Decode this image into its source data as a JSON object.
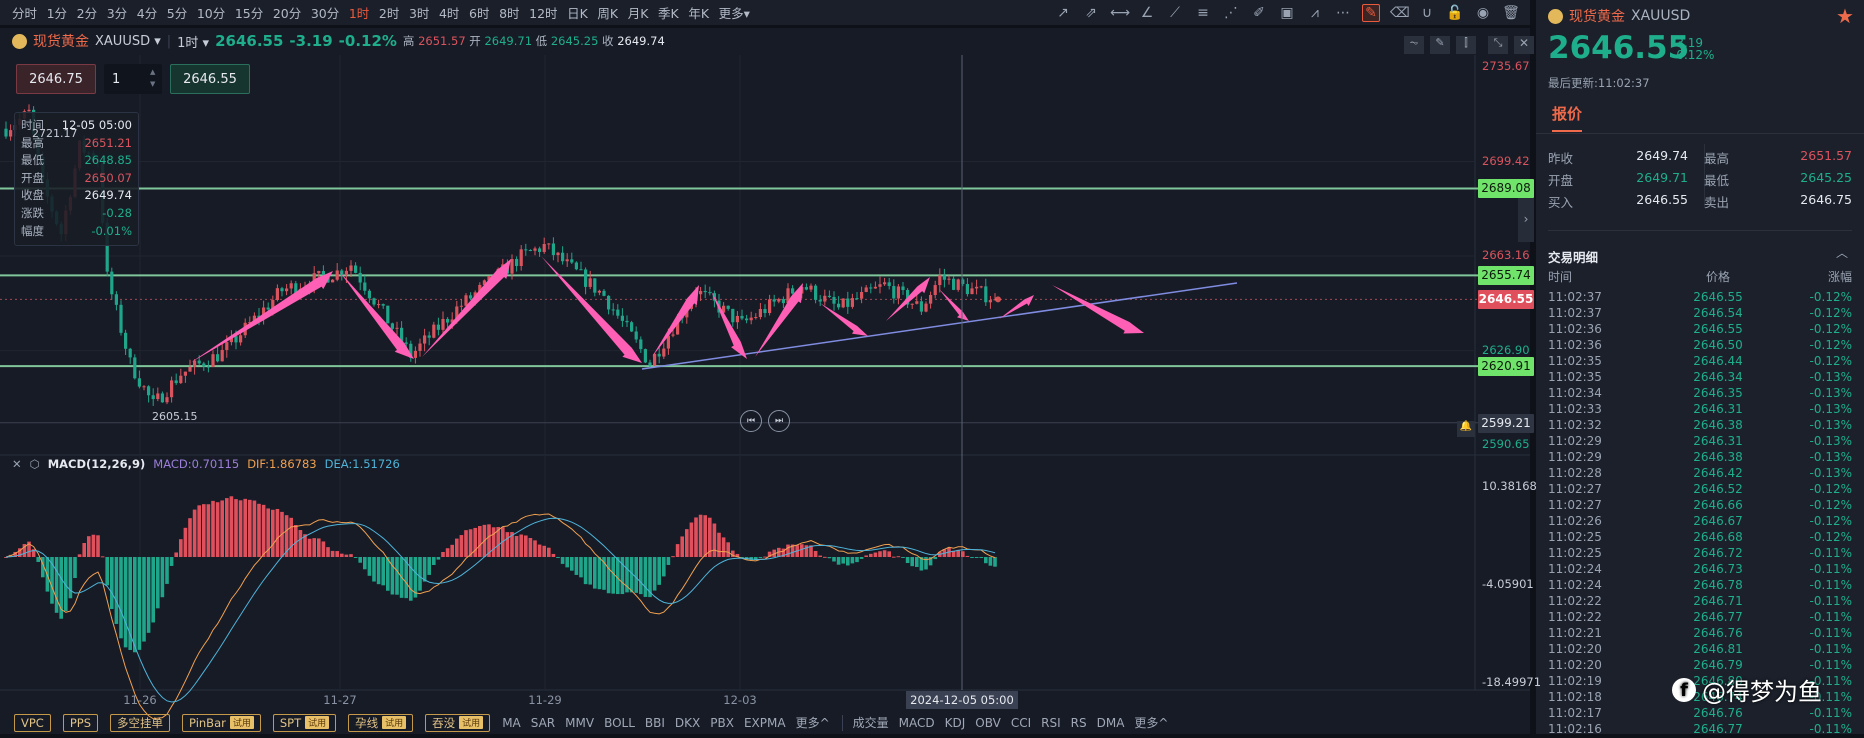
{
  "toolbar": {
    "intervals": [
      "分时",
      "1分",
      "2分",
      "3分",
      "4分",
      "5分",
      "10分",
      "15分",
      "20分",
      "30分",
      "1时",
      "2时",
      "3时",
      "4时",
      "6时",
      "8时",
      "12时",
      "日K",
      "周K",
      "月K",
      "季K",
      "年K",
      "更多▾"
    ],
    "active_index": 10,
    "drawing_tools": [
      "arrow-icon",
      "ray-icon",
      "horizontal-line-icon",
      "trend-angle-icon",
      "segment-icon",
      "fibonacci-icon",
      "fan-icon",
      "marker-icon",
      "image-icon",
      "pattern-icon",
      "more-icon",
      "edit-icon",
      "eraser-icon",
      "magnet-icon",
      "lock-icon",
      "eye-icon",
      "trash-icon"
    ]
  },
  "header": {
    "symbol": "现货黄金",
    "code": "XAUUSD ▾",
    "interval": "1时 ▾",
    "price": "2646.55",
    "change": "-3.19",
    "pct": "-0.12%",
    "high_label": "高",
    "high": "2651.57",
    "open_label": "开",
    "open": "2649.71",
    "low_label": "低",
    "low": "2645.25",
    "close_label": "收",
    "close": "2649.74"
  },
  "order": {
    "sell": "2646.75",
    "qty": "1",
    "buy": "2646.55"
  },
  "tooltip": [
    {
      "k": "时间",
      "v": "12-05 05:00",
      "c": "white"
    },
    {
      "k": "最高",
      "v": "2651.21",
      "c": "red"
    },
    {
      "k": "最低",
      "v": "2648.85",
      "c": "green"
    },
    {
      "k": "开盘",
      "v": "2650.07",
      "c": "red"
    },
    {
      "k": "收盘",
      "v": "2649.74",
      "c": "white"
    },
    {
      "k": "涨跌",
      "v": "-0.28",
      "c": "green"
    },
    {
      "k": "幅度",
      "v": "-0.01%",
      "c": "green"
    }
  ],
  "price_axis": {
    "ticks": [
      {
        "v": "2735.67",
        "p": 2735.67,
        "c": "red"
      },
      {
        "v": "2699.42",
        "p": 2699.42,
        "c": "red"
      },
      {
        "v": "2663.16",
        "p": 2663.16,
        "c": "red"
      },
      {
        "v": "2626.90",
        "p": 2626.9,
        "c": "green"
      },
      {
        "v": "2590.65",
        "p": 2590.65,
        "c": "green"
      }
    ],
    "lines": [
      {
        "v": "2689.08",
        "p": 2689.08
      },
      {
        "v": "2655.74",
        "p": 2655.74
      },
      {
        "v": "2620.91",
        "p": 2620.91
      }
    ],
    "current": {
      "v": "2646.55",
      "p": 2646.55
    },
    "alert": {
      "v": "2599.21",
      "p": 2599.21
    },
    "max_label": "2721.17",
    "min_label": "2605.15"
  },
  "chart": {
    "price_path": [
      [
        0,
        2712
      ],
      [
        5,
        2718
      ],
      [
        8,
        2690
      ],
      [
        12,
        2672
      ],
      [
        16,
        2705
      ],
      [
        20,
        2700
      ],
      [
        22,
        2655
      ],
      [
        27,
        2622
      ],
      [
        32,
        2606
      ],
      [
        38,
        2618
      ],
      [
        47,
        2626
      ],
      [
        60,
        2650
      ],
      [
        72,
        2657
      ],
      [
        75,
        2660
      ],
      [
        88,
        2625
      ],
      [
        98,
        2643
      ],
      [
        112,
        2663
      ],
      [
        117,
        2667
      ],
      [
        130,
        2648
      ],
      [
        140,
        2622
      ],
      [
        150,
        2650
      ],
      [
        160,
        2637
      ],
      [
        173,
        2652
      ],
      [
        181,
        2643
      ],
      [
        191,
        2652
      ],
      [
        199,
        2643
      ],
      [
        203,
        2655
      ],
      [
        210,
        2650
      ],
      [
        215,
        2647
      ]
    ],
    "up_color": "#d9545e",
    "down_color": "#1fa58a"
  },
  "macd": {
    "title": "MACD(12,26,9)",
    "macd": "MACD:0.70115",
    "dif": "DIF:1.86783",
    "dea": "DEA:1.51726",
    "ticks": [
      {
        "v": "10.38168",
        "n": 10.38168
      },
      {
        "v": "-4.05901",
        "n": -4.05901
      },
      {
        "v": "-18.49971",
        "n": -18.49971
      }
    ]
  },
  "xaxis": {
    "labels": [
      "11-26",
      "11-27",
      "11-29",
      "12-03"
    ],
    "crosshair": "2024-12-05 05:00"
  },
  "bottom": {
    "pills": [
      {
        "label": "VPC"
      },
      {
        "label": "PPS"
      },
      {
        "label": "多空挂单"
      },
      {
        "label": "PinBar",
        "badge": "试用"
      },
      {
        "label": "SPT",
        "badge": "试用"
      },
      {
        "label": "孕线",
        "badge": "试用"
      },
      {
        "label": "吞没",
        "badge": "试用"
      }
    ],
    "main": [
      "MA",
      "SAR",
      "MMV",
      "BOLL",
      "BBI",
      "DKX",
      "PBX",
      "EXPMA",
      "更多^"
    ],
    "sub": [
      "成交量",
      "MACD",
      "KDJ",
      "OBV",
      "CCI",
      "RSI",
      "RS",
      "DMA",
      "更多^"
    ]
  },
  "panel": {
    "symbol": "现货黄金",
    "code": "XAUUSD",
    "price": "2646.55",
    "change": "-3.19",
    "pct": "-0.12%",
    "updated": "最后更新:11:02:37",
    "tab": "报价",
    "quote": [
      {
        "k": "昨收",
        "v": "2649.74",
        "c": "white"
      },
      {
        "k": "最高",
        "v": "2651.57",
        "c": "red"
      },
      {
        "k": "开盘",
        "v": "2649.71",
        "c": "green"
      },
      {
        "k": "最低",
        "v": "2645.25",
        "c": "green"
      },
      {
        "k": "买入",
        "v": "2646.55",
        "c": "white"
      },
      {
        "k": "卖出",
        "v": "2646.75",
        "c": "white"
      }
    ],
    "trades_title": "交易明细",
    "cols": [
      "时间",
      "价格",
      "涨幅"
    ],
    "trades": [
      [
        "11:02:37",
        "2646.55",
        "-0.12%"
      ],
      [
        "11:02:37",
        "2646.54",
        "-0.12%"
      ],
      [
        "11:02:36",
        "2646.55",
        "-0.12%"
      ],
      [
        "11:02:36",
        "2646.50",
        "-0.12%"
      ],
      [
        "11:02:35",
        "2646.44",
        "-0.12%"
      ],
      [
        "11:02:35",
        "2646.34",
        "-0.13%"
      ],
      [
        "11:02:34",
        "2646.35",
        "-0.13%"
      ],
      [
        "11:02:33",
        "2646.31",
        "-0.13%"
      ],
      [
        "11:02:32",
        "2646.38",
        "-0.13%"
      ],
      [
        "11:02:29",
        "2646.31",
        "-0.13%"
      ],
      [
        "11:02:29",
        "2646.38",
        "-0.13%"
      ],
      [
        "11:02:28",
        "2646.42",
        "-0.13%"
      ],
      [
        "11:02:27",
        "2646.52",
        "-0.12%"
      ],
      [
        "11:02:27",
        "2646.66",
        "-0.12%"
      ],
      [
        "11:02:26",
        "2646.67",
        "-0.12%"
      ],
      [
        "11:02:25",
        "2646.68",
        "-0.12%"
      ],
      [
        "11:02:25",
        "2646.72",
        "-0.11%"
      ],
      [
        "11:02:24",
        "2646.73",
        "-0.11%"
      ],
      [
        "11:02:24",
        "2646.78",
        "-0.11%"
      ],
      [
        "11:02:22",
        "2646.71",
        "-0.11%"
      ],
      [
        "11:02:22",
        "2646.77",
        "-0.11%"
      ],
      [
        "11:02:21",
        "2646.76",
        "-0.11%"
      ],
      [
        "11:02:20",
        "2646.81",
        "-0.11%"
      ],
      [
        "11:02:20",
        "2646.79",
        "-0.11%"
      ],
      [
        "11:02:19",
        "2646.80",
        "-0.11%"
      ],
      [
        "11:02:18",
        "2646.74",
        "-0.11%"
      ],
      [
        "11:02:17",
        "2646.76",
        "-0.11%"
      ],
      [
        "11:02:16",
        "2646.77",
        "-0.11%"
      ]
    ]
  },
  "watermark": "@得梦为鱼"
}
